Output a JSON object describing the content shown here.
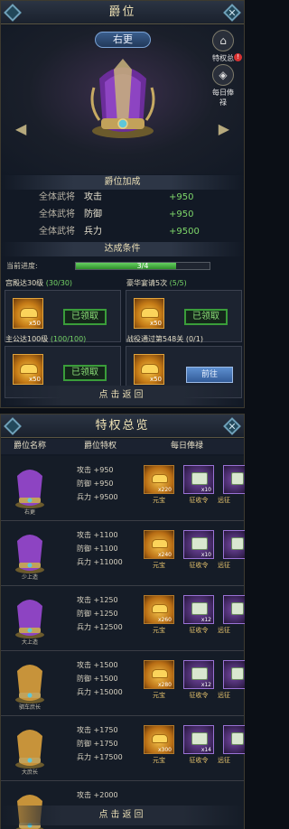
{
  "top": {
    "title": "爵位",
    "current_rank": "右更",
    "side_buttons": [
      {
        "label": "特权总览"
      },
      {
        "label": "每日俸禄"
      }
    ],
    "badge": "!",
    "bonus_title": "爵位加成",
    "bonus_rows": [
      {
        "target": "全体武将",
        "stat": "攻击",
        "value": "+950"
      },
      {
        "target": "全体武将",
        "stat": "防御",
        "value": "+950"
      },
      {
        "target": "全体武将",
        "stat": "兵力",
        "value": "+9500"
      }
    ],
    "cond_title": "达成条件",
    "progress_label": "当前进度:",
    "progress_text": "3/4",
    "progress_value": 0.75,
    "tasks": [
      {
        "title": "宫殿达30级",
        "progress": "(30/30)",
        "reward_qty": "x50",
        "action": "已领取"
      },
      {
        "title": "豪华宴请5次",
        "progress": "(5/5)",
        "reward_qty": "x50",
        "action": "已领取"
      },
      {
        "title": "主公达100级",
        "progress": "(100/100)",
        "reward_qty": "x50",
        "action": "已领取"
      },
      {
        "title": "战役通过第548关",
        "progress": "(0/1)",
        "reward_qty": "x50",
        "action": "前往"
      }
    ],
    "back": "点击返回"
  },
  "bottom": {
    "title": "特权总览",
    "headers": {
      "rank": "爵位名称",
      "privilege": "爵位特权",
      "salary": "每日俸禄"
    },
    "rows": [
      {
        "name": "右更",
        "atk": "攻击 +950",
        "def": "防御 +950",
        "troops": "兵力 +9500",
        "gold": "x220",
        "ticket": "x10",
        "gold_label": "元宝",
        "ticket_label": "征收令",
        "extra_label": "远征"
      },
      {
        "name": "少上造",
        "atk": "攻击 +1100",
        "def": "防御 +1100",
        "troops": "兵力 +11000",
        "gold": "x240",
        "ticket": "x10",
        "gold_label": "元宝",
        "ticket_label": "征收令",
        "extra_label": "远征"
      },
      {
        "name": "大上造",
        "atk": "攻击 +1250",
        "def": "防御 +1250",
        "troops": "兵力 +12500",
        "gold": "x260",
        "ticket": "x12",
        "gold_label": "元宝",
        "ticket_label": "征收令",
        "extra_label": "远征"
      },
      {
        "name": "驷车庶长",
        "atk": "攻击 +1500",
        "def": "防御 +1500",
        "troops": "兵力 +15000",
        "gold": "x280",
        "ticket": "x12",
        "gold_label": "元宝",
        "ticket_label": "征收令",
        "extra_label": "远征"
      },
      {
        "name": "大庶长",
        "atk": "攻击 +1750",
        "def": "防御 +1750",
        "troops": "兵力 +17500",
        "gold": "x300",
        "ticket": "x14",
        "gold_label": "元宝",
        "ticket_label": "征收令",
        "extra_label": "远征"
      },
      {
        "name": "",
        "atk": "攻击 +2000",
        "def": "",
        "troops": "",
        "gold": "",
        "ticket": "",
        "gold_label": "",
        "ticket_label": "",
        "extra_label": ""
      }
    ],
    "back": "点击返回"
  },
  "colors": {
    "accent_green": "#7ed76a",
    "gold": "#f6c548",
    "purple": "#7a4aa8"
  }
}
